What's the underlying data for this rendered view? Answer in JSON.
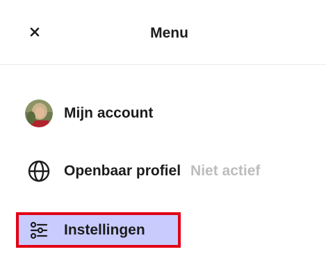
{
  "header": {
    "title": "Menu",
    "close_icon": "close-icon"
  },
  "menu": {
    "items": [
      {
        "label": "Mijn account",
        "icon": "avatar"
      },
      {
        "label": "Openbaar profiel",
        "status": "Niet actief",
        "icon": "globe-icon"
      },
      {
        "label": "Instellingen",
        "icon": "sliders-icon",
        "highlighted": true
      }
    ]
  },
  "colors": {
    "highlight_background": "#c9cbff",
    "highlight_border": "#e10012",
    "status_text": "#bdbdbd"
  }
}
